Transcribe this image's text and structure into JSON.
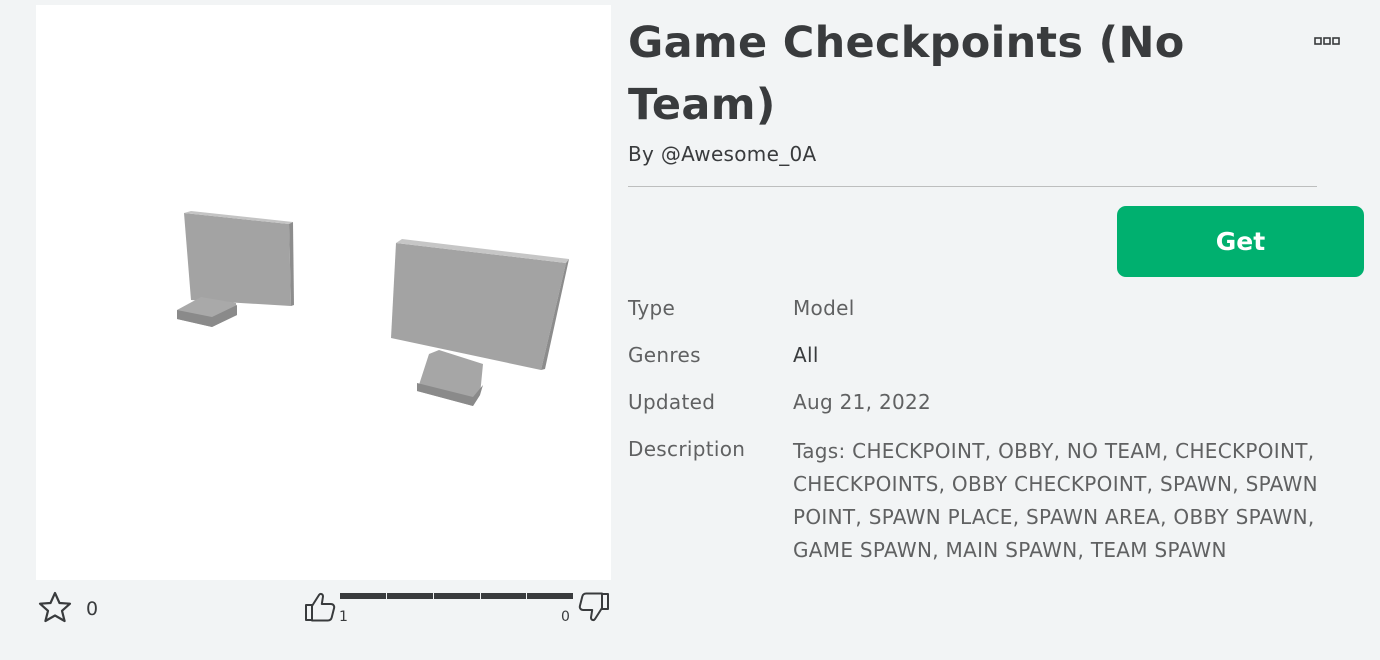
{
  "item": {
    "title": "Game Checkpoints (No Team)",
    "creator": "By @Awesome_0A",
    "get_label": "Get"
  },
  "engagement": {
    "favorites": "0",
    "upvotes": "1",
    "downvotes": "0"
  },
  "info": {
    "type_label": "Type",
    "type_value": "Model",
    "genres_label": "Genres",
    "genres_value": "All",
    "updated_label": "Updated",
    "updated_value": "Aug 21, 2022",
    "description_label": "Description",
    "description_value": "Tags: CHECKPOINT, OBBY, NO TEAM, CHECKPOINT, CHECKPOINTS, OBBY CHECKPOINT, SPAWN, SPAWN POINT, SPAWN PLACE, SPAWN AREA, OBBY SPAWN, GAME SPAWN, MAIN SPAWN, TEAM SPAWN"
  },
  "icons": {
    "favorite": "star-outline-icon",
    "upvote": "thumbs-up-icon",
    "downvote": "thumbs-down-icon",
    "more": "more-options-icon"
  },
  "colors": {
    "get_button": "#00b06f",
    "background": "#f2f4f5",
    "text": "#393b3d"
  }
}
